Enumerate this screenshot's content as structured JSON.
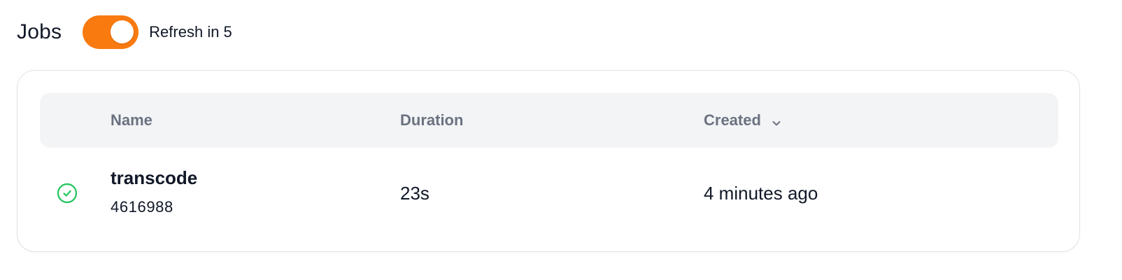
{
  "header": {
    "title": "Jobs",
    "refresh_label": "Refresh in 5",
    "auto_refresh_enabled": true,
    "accent_color": "#f97a0f"
  },
  "table": {
    "columns": {
      "name": "Name",
      "duration": "Duration",
      "created": "Created"
    },
    "sort_icon": "chevron-down-icon",
    "rows": [
      {
        "status": "success",
        "status_icon": "check-circle-icon",
        "status_color": "#22c55e",
        "name": "transcode",
        "id": "4616988",
        "duration": "23s",
        "created": "4 minutes ago"
      }
    ]
  }
}
